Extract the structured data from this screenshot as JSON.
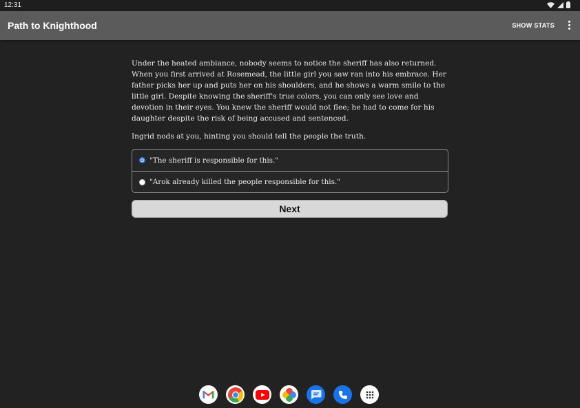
{
  "status_bar": {
    "time": "12:31"
  },
  "app_bar": {
    "title": "Path to Knighthood",
    "show_stats_label": "SHOW STATS"
  },
  "story": {
    "paragraphs": [
      "Under the heated ambiance, nobody seems to notice the sheriff has also returned. When you first arrived at Rosemead, the little girl you saw ran into his embrace. Her father picks her up and puts her on his shoulders, and he shows a warm smile to the little girl. Despite knowing the sheriff's true colors, you can only see love and devotion in their eyes. You knew the sheriff would not flee; he had to come for his daughter despite the risk of being accused and sentenced.",
      "Ingrid nods at you, hinting you should tell the people the truth."
    ]
  },
  "choices": [
    {
      "label": "\"The sheriff is responsible for this.\"",
      "selected": true
    },
    {
      "label": "\"Arok already killed the people responsible for this.\"",
      "selected": false
    }
  ],
  "next_label": "Next",
  "dock_apps": [
    "gmail-icon",
    "chrome-icon",
    "youtube-icon",
    "photos-icon",
    "messages-icon",
    "phone-icon",
    "app-drawer-icon"
  ],
  "colors": {
    "app_bar": "#5b5b5b",
    "background": "#222222",
    "radio_accent": "#2f7ae5",
    "button": "#d8d8d8"
  }
}
